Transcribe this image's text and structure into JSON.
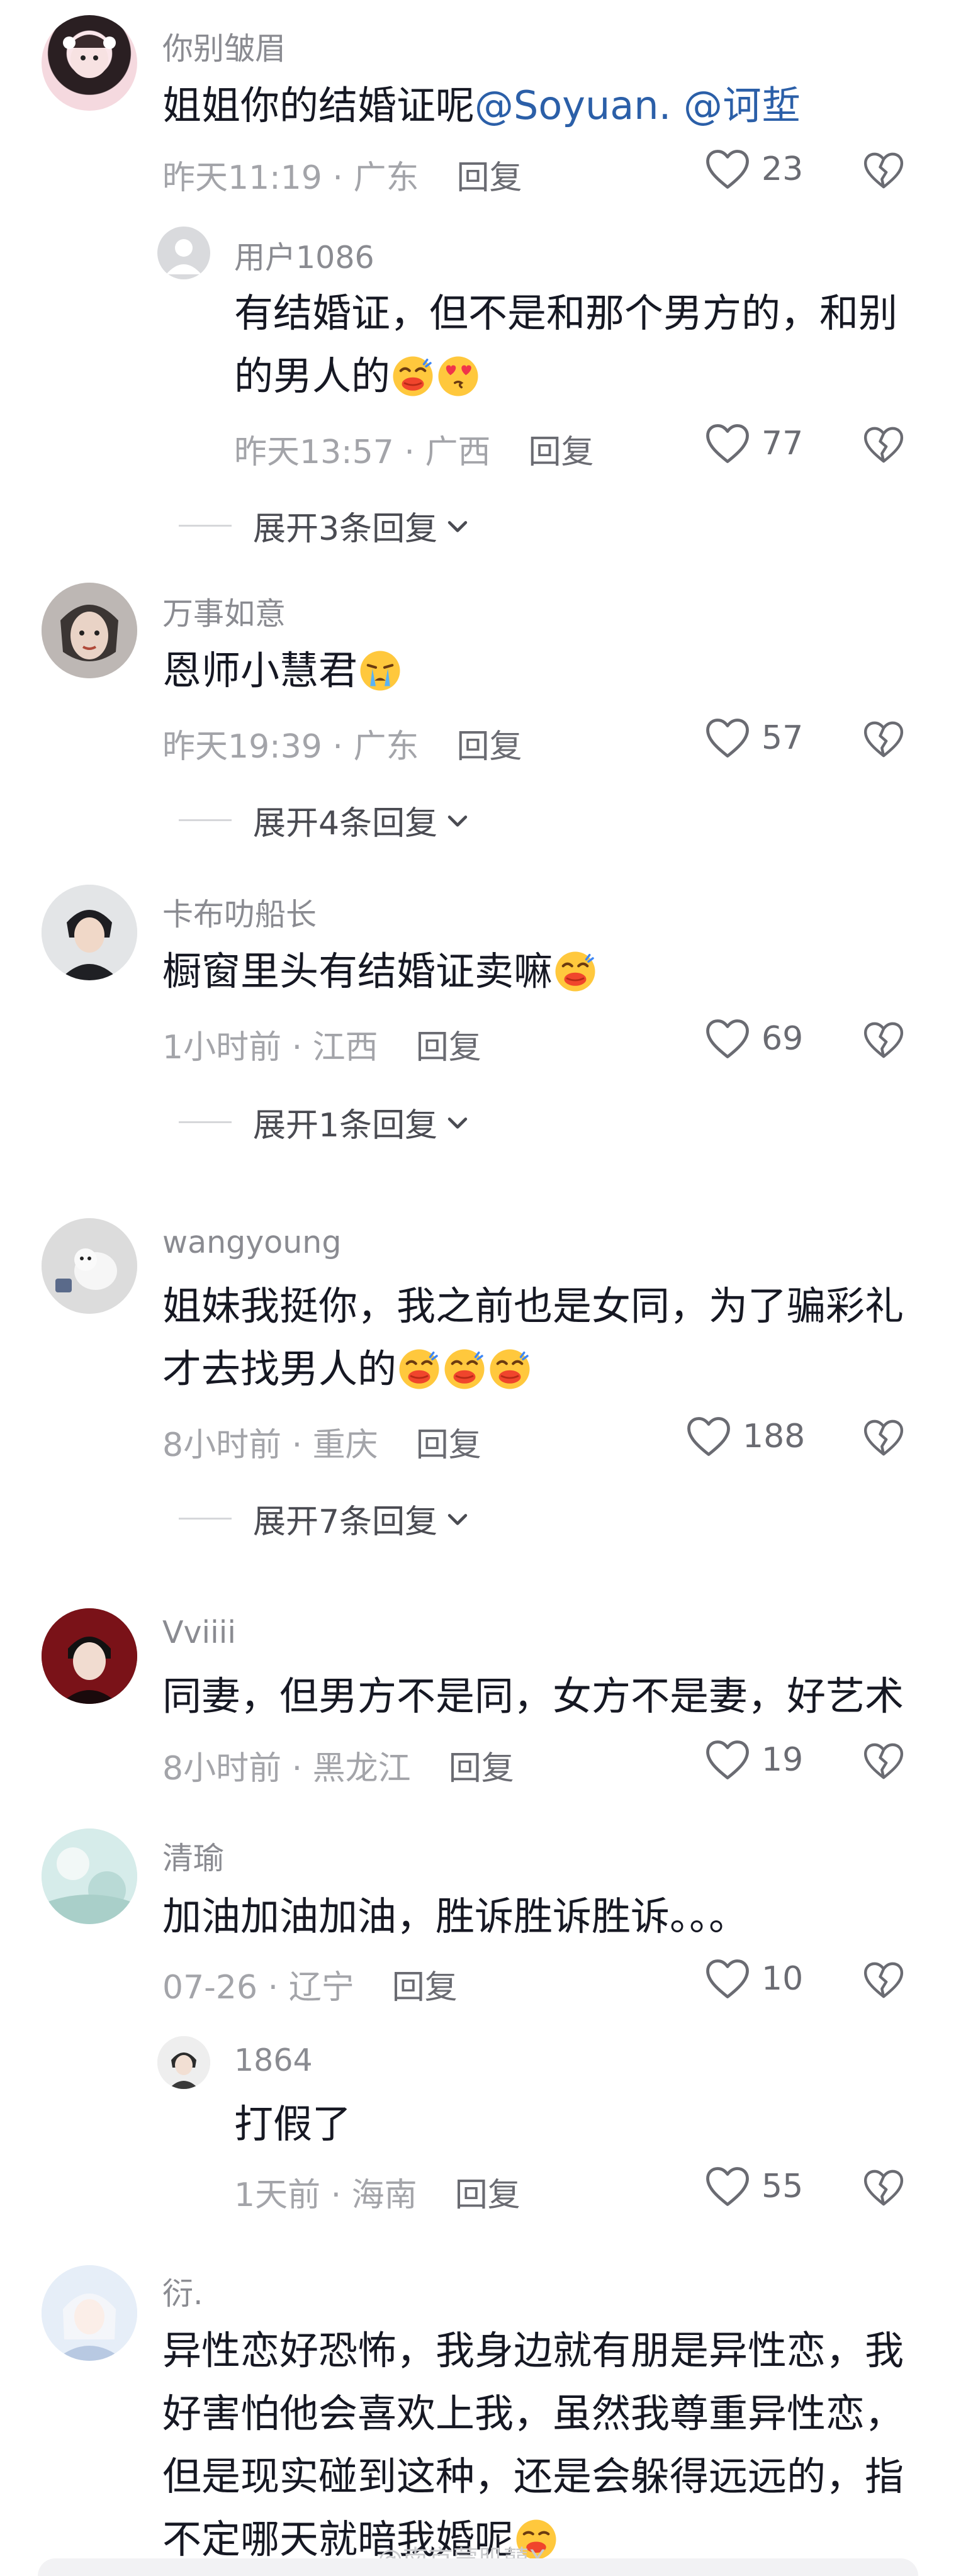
{
  "colors": {
    "text": "#161823",
    "meta": "#a3a4a9",
    "mention": "#2b5fa8",
    "icon": "#6a6b72"
  },
  "comments": [
    {
      "username": "你别皱眉",
      "text_before": "姐姐你的结婚证呢",
      "mention": "@Soyuan. @诃埑",
      "time": "昨天11:19 · 广东",
      "reply": "回复",
      "likes": "23",
      "replies": [
        {
          "username": "用户1086",
          "text_line1": "有结婚证，但不是和那个男方的，和别",
          "text_line2": "的男人的",
          "emojis": [
            "laughing-kiss",
            "heart-eyes"
          ],
          "time": "昨天13:57 · 广西",
          "reply": "回复",
          "likes": "77"
        }
      ],
      "expand": "展开3条回复"
    },
    {
      "username": "万事如意",
      "text": "恩师小慧君",
      "emojis": [
        "crying"
      ],
      "time": "昨天19:39 · 广东",
      "reply": "回复",
      "likes": "57",
      "expand": "展开4条回复"
    },
    {
      "username": "卡布叻船长",
      "text": "橱窗里头有结婚证卖嘛",
      "emojis": [
        "laughing-kiss"
      ],
      "time": "1小时前 · 江西",
      "reply": "回复",
      "likes": "69",
      "expand": "展开1条回复"
    },
    {
      "username": "wangyoung",
      "text_line1": "姐妹我挺你，我之前也是女同，为了骗彩礼",
      "text_line2": "才去找男人的",
      "emojis": [
        "laughing-kiss",
        "laughing-kiss",
        "laughing-kiss"
      ],
      "time": "8小时前 · 重庆",
      "reply": "回复",
      "likes": "188",
      "expand": "展开7条回复"
    },
    {
      "username": "Vviiii",
      "text": "同妻，但男方不是同，女方不是妻，好艺术",
      "time": "8小时前 · 黑龙江",
      "reply": "回复",
      "likes": "19"
    },
    {
      "username": "清瑜",
      "text": "加油加油加油，胜诉胜诉胜诉。。。",
      "time": "07-26 · 辽宁",
      "reply": "回复",
      "likes": "10",
      "replies": [
        {
          "username": "1864",
          "text": "打假了",
          "time": "1天前 · 海南",
          "reply": "回复",
          "likes": "55"
        }
      ]
    },
    {
      "username": "衍.",
      "text_line1": "异性恋好恐怖，我身边就有朋是异性恋，我",
      "text_line2": "好害怕他会喜欢上我，虽然我尊重异性恋，",
      "text_line3": "但是现实碰到这种，还是会躲得远远的，指",
      "text_line4": "不定哪天就暗我婚呢",
      "emojis": [
        "smirk"
      ]
    }
  ],
  "watermark": "@南京蒙肌囍X"
}
